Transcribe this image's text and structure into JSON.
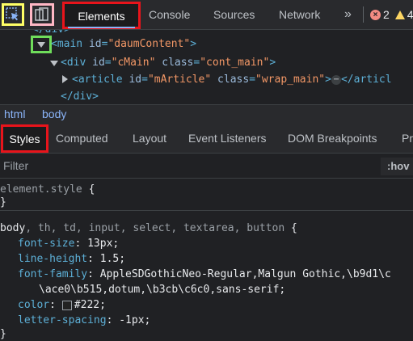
{
  "toolbar": {
    "inspect_icon": "inspect-element-icon",
    "device_icon": "device-toolbar-icon",
    "tabs": [
      {
        "label": "Elements"
      },
      {
        "label": "Console"
      },
      {
        "label": "Sources"
      },
      {
        "label": "Network"
      }
    ],
    "more_tabs": "»",
    "error_count": "2",
    "warning_count": "4",
    "error_icon": "×"
  },
  "dom": {
    "lines": [
      {
        "open": "<main ",
        "attr": "id",
        "eq": "=",
        "val": "\"daumContent\"",
        "close": ">"
      },
      {
        "open": "<div ",
        "attr1": "id",
        "val1": "\"cMain\"",
        "attr2": "class",
        "val2": "\"cont_main\"",
        "close": ">"
      },
      {
        "open": "<article ",
        "attr1": "id",
        "val1": "\"mArticle\"",
        "attr2": "class",
        "val2": "\"wrap_main\"",
        "ellipsis": "⋯",
        "end": "</articl"
      },
      {
        "text": "</div>"
      }
    ]
  },
  "breadcrumb": {
    "items": [
      "html",
      "body"
    ]
  },
  "styles_tabs": [
    "Styles",
    "Computed",
    "Layout",
    "Event Listeners",
    "DOM Breakpoints",
    "Pr"
  ],
  "filter": {
    "placeholder": "Filter",
    "hov": ":hov"
  },
  "rules": {
    "element_style": {
      "selector": "element.style",
      "brace_open": " {",
      "brace_close": "}"
    },
    "body_rule": {
      "selector_main": "body",
      "selector_rest": ", th, td, input, select, textarea, button",
      "brace_open": " {",
      "props": [
        {
          "name": "font-size",
          "value": "13px;"
        },
        {
          "name": "line-height",
          "value": "1.5;"
        },
        {
          "name": "font-family",
          "value": "AppleSDGothicNeo-Regular,Malgun Gothic,\\b9d1\\c",
          "value2": "\\ace0\\b515,dotum,\\b3cb\\c6c0,sans-serif;"
        },
        {
          "name": "color",
          "value": "#222;",
          "swatch": "#222222"
        },
        {
          "name": "letter-spacing",
          "value": "-1px;"
        }
      ],
      "brace_close": "}"
    }
  }
}
